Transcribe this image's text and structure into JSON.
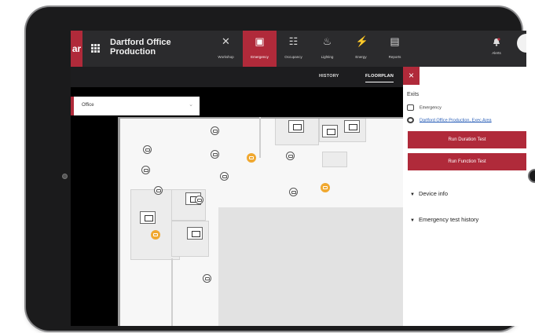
{
  "app": {
    "menu_tag": "ar",
    "site_title": "Dartford Office Production"
  },
  "nav": [
    {
      "key": "workshop",
      "label": "Workshop",
      "icon": "tools-icon",
      "glyph": "✕"
    },
    {
      "key": "emergency",
      "label": "Emergency",
      "icon": "emergency-exit-icon",
      "glyph": "▣"
    },
    {
      "key": "occupancy",
      "label": "Occupancy",
      "icon": "people-icon",
      "glyph": "☷"
    },
    {
      "key": "lighting",
      "label": "Lighting",
      "icon": "lighting-icon",
      "glyph": "♨"
    },
    {
      "key": "energy",
      "label": "Energy",
      "icon": "lightning-icon",
      "glyph": "⚡"
    },
    {
      "key": "reports",
      "label": "Reports",
      "icon": "report-icon",
      "glyph": "▤"
    }
  ],
  "nav_active": "emergency",
  "alerts_label": "Alerts",
  "subtabs": {
    "history": "HISTORY",
    "floorplan": "FLOORPLAN"
  },
  "floor_select": {
    "value": "Office"
  },
  "panel": {
    "close_glyph": "×",
    "title": "Exits",
    "type_label": "Emergency",
    "location_link": "Dartford Office Production, Exec Area",
    "run_duration": "Run Duration Test",
    "run_function": "Run Function Test",
    "device_info": "Device info",
    "emergency_history": "Emergency test history"
  },
  "colors": {
    "accent": "#b02a3a",
    "warning": "#f0a830",
    "topbar": "#2b2b2d"
  }
}
